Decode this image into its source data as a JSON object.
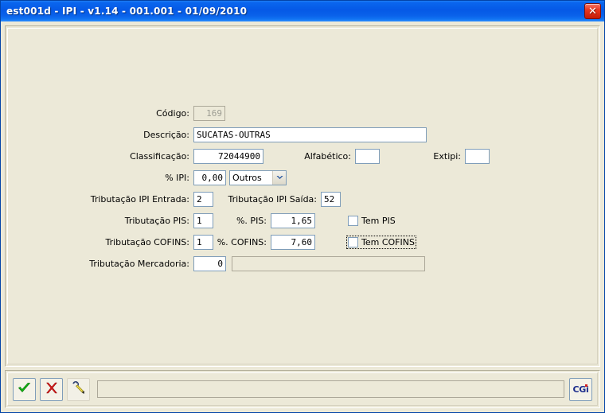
{
  "window": {
    "title": "est001d - IPI - v1.14 - 001.001 - 01/09/2010",
    "close_label": "✕"
  },
  "form": {
    "codigo": {
      "label": "Código:",
      "value": "169"
    },
    "descricao": {
      "label": "Descrição:",
      "value": "SUCATAS-OUTRAS"
    },
    "classificacao": {
      "label": "Classificação:",
      "value": "72044900"
    },
    "alfabetico": {
      "label": "Alfabético:",
      "value": ""
    },
    "extipi": {
      "label": "Extipi:",
      "value": ""
    },
    "pct_ipi": {
      "label": "% IPI:",
      "value": "0,00"
    },
    "ipi_tipo": {
      "selected": "Outros",
      "arrow_icon": "chevron-down-icon"
    },
    "trib_ipi_entrada": {
      "label": "Tributação IPI Entrada:",
      "value": "2"
    },
    "trib_ipi_saida": {
      "label": "Tributação IPI Saída:",
      "value": "52"
    },
    "trib_pis": {
      "label": "Tributação PIS:",
      "value": "1"
    },
    "pct_pis": {
      "label": "%. PIS:",
      "value": "1,65"
    },
    "tem_pis": {
      "label": "Tem PIS",
      "checked": false
    },
    "trib_cofins": {
      "label": "Tributação COFINS:",
      "value": "1"
    },
    "pct_cofins": {
      "label": "%. COFINS:",
      "value": "7,60"
    },
    "tem_cofins": {
      "label": "Tem COFINS",
      "checked": false,
      "focused": true
    },
    "trib_mercadoria": {
      "label": "Tributação Mercadoria:",
      "value": "0",
      "description_value": ""
    }
  },
  "toolbar": {
    "confirm_icon": "check-icon",
    "cancel_icon": "x-icon",
    "search_icon": "magic-wand-icon",
    "status_value": "",
    "brand_label": "CGi"
  },
  "colors": {
    "titlebar_blue": "#0559e6",
    "frame_blue": "#0a5fe0",
    "panel_beige": "#ece9d8",
    "field_border": "#7f9db9",
    "check_green": "#00a000",
    "cancel_red": "#cc0000",
    "brand_blue": "#1c2c8c",
    "brand_red": "#d42020"
  }
}
